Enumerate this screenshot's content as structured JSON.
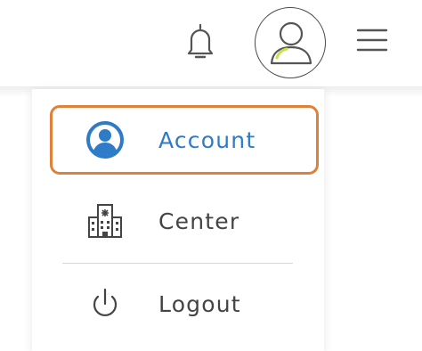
{
  "header": {
    "notification_icon": "bell-icon",
    "profile_icon": "user-avatar-icon",
    "menu_icon": "hamburger-menu-icon"
  },
  "dropdown": {
    "items": [
      {
        "label": "Account",
        "icon": "user-circle-icon",
        "selected": true
      },
      {
        "label": "Center",
        "icon": "building-icon",
        "selected": false
      },
      {
        "label": "Logout",
        "icon": "power-icon",
        "selected": false
      }
    ]
  },
  "colors": {
    "accent": "#2e7bc8",
    "focus_ring": "#e0813a",
    "avatar_highlight": "#c8e04a",
    "text": "#444444"
  }
}
